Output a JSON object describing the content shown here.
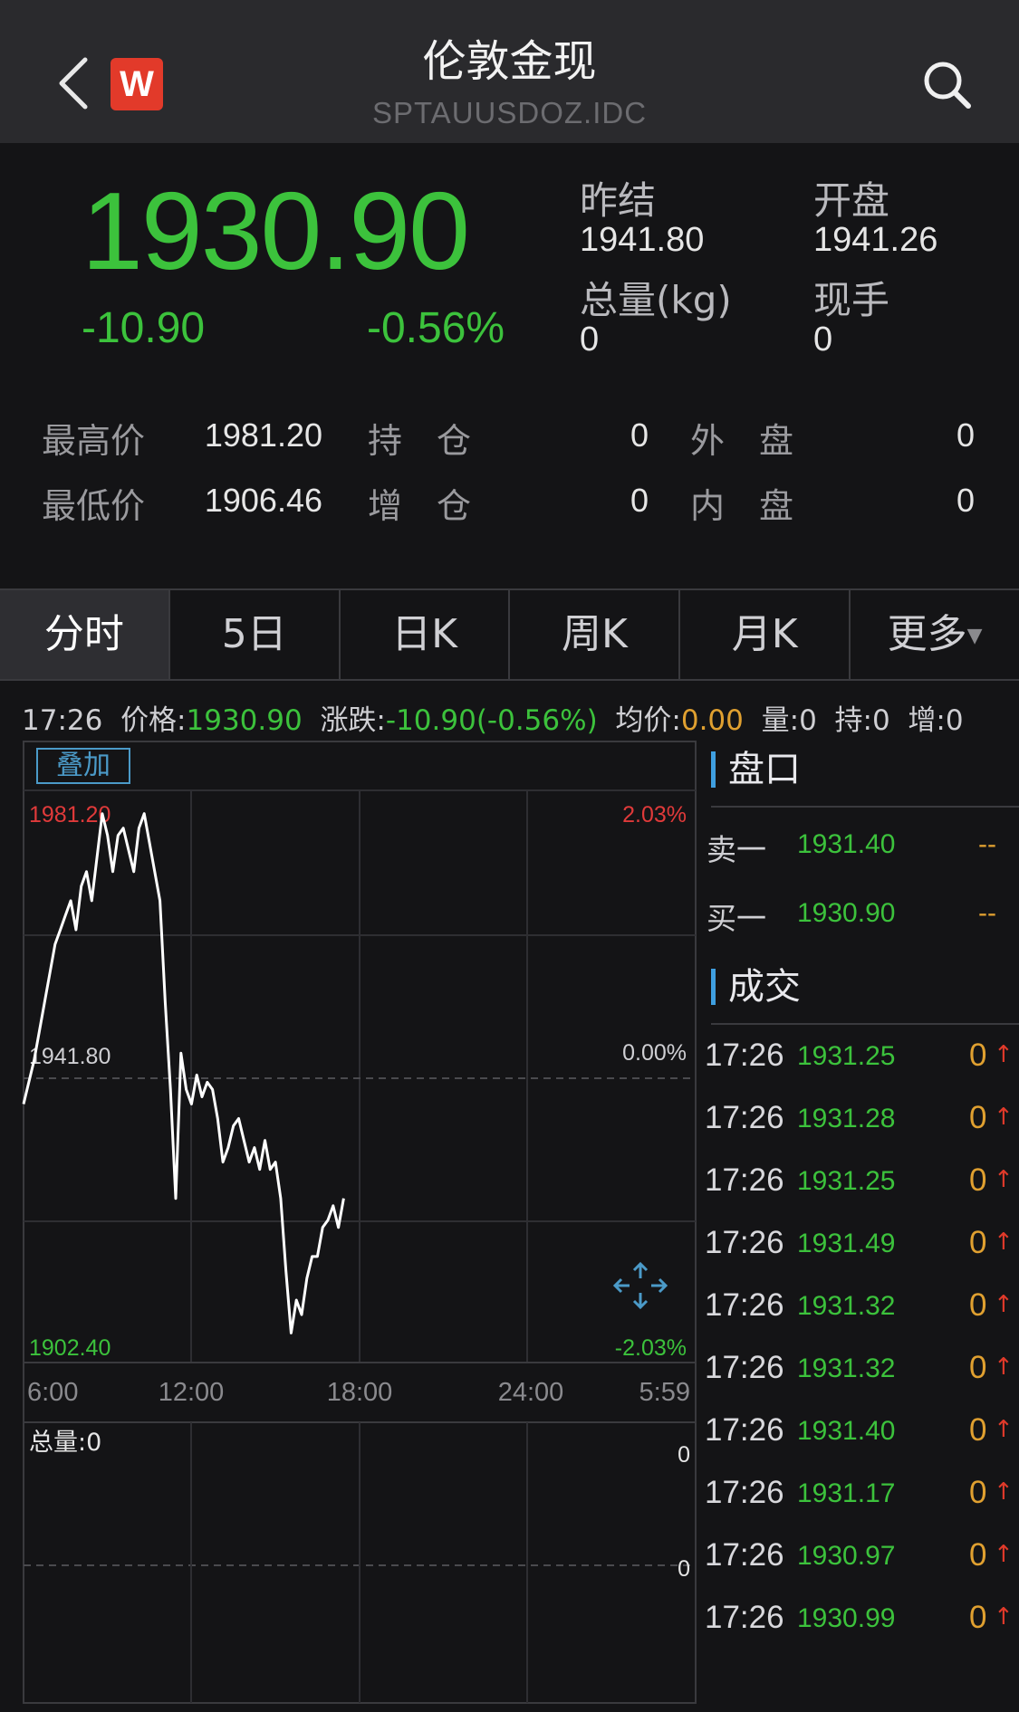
{
  "header": {
    "title": "伦敦金现",
    "subtitle": "SPTAUUSDOZ.IDC",
    "logo_text": "W",
    "back_icon": "chevron-left-icon",
    "search_icon": "search-icon",
    "logo_color": "#e23a2a"
  },
  "quote": {
    "price": "1930.90",
    "change": "-10.90",
    "change_pct": "-0.56%",
    "prev_settle_label": "昨结",
    "prev_settle": "1941.80",
    "open_label": "开盘",
    "open": "1941.26",
    "volume_label": "总量(kg)",
    "volume": "0",
    "current_hand_label": "现手",
    "current_hand": "0",
    "color_down": "#3cc23c"
  },
  "stats": {
    "high_label": "最高价",
    "high": "1981.20",
    "low_label": "最低价",
    "low": "1906.46",
    "open_interest_label": "持　仓",
    "open_interest": "0",
    "oi_change_label": "增　仓",
    "oi_change": "0",
    "outer_label": "外　盘",
    "outer": "0",
    "inner_label": "内　盘",
    "inner": "0"
  },
  "tabs": [
    {
      "label": "分时",
      "active": true
    },
    {
      "label": "5日"
    },
    {
      "label": "日K"
    },
    {
      "label": "周K"
    },
    {
      "label": "月K"
    },
    {
      "label": "更多"
    }
  ],
  "infobar": {
    "time": "17:26",
    "price_label": "价格:",
    "price": "1930.90",
    "chg_label": "涨跌:",
    "chg": "-10.90(-0.56%)",
    "avg_label": "均价:",
    "avg": "0.00",
    "vol_label": "量:",
    "vol": "0",
    "hold_label": "持:",
    "hold": "0",
    "inc_label": "增:",
    "inc": "0"
  },
  "chart": {
    "overlay_button": "叠加",
    "y_top": "1981.20",
    "y_mid": "1941.80",
    "y_bottom": "1902.40",
    "pct_top": "2.03%",
    "pct_mid": "0.00%",
    "pct_bottom": "-2.03%",
    "x_labels": [
      "6:00",
      "12:00",
      "18:00",
      "24:00",
      "5:59"
    ],
    "volume_label": "总量:0",
    "vol_axis_top": "0",
    "vol_axis_mid": "0",
    "expand_icon": "expand-arrows-icon"
  },
  "chart_data": {
    "type": "line",
    "title": "",
    "xlabel": "",
    "ylabel": "",
    "x_range": [
      "6:00",
      "5:59"
    ],
    "ylim": [
      1902.4,
      1981.2
    ],
    "reference": 1941.8,
    "series": [
      {
        "values": [
          1938,
          1941,
          1944,
          1948,
          1952,
          1956,
          1960,
          1962,
          1964,
          1966,
          1962,
          1968,
          1970,
          1966,
          1972,
          1978,
          1975,
          1970,
          1975,
          1976,
          1973,
          1970,
          1976,
          1978,
          1974,
          1970,
          1966,
          1952,
          1940,
          1925,
          1945,
          1940,
          1938,
          1942,
          1939,
          1941,
          1940,
          1936,
          1930,
          1932,
          1935,
          1936,
          1933,
          1930,
          1932,
          1929,
          1933,
          1929,
          1930,
          1925,
          1915,
          1906.46,
          1911,
          1909,
          1914,
          1917,
          1917,
          1921,
          1922,
          1924,
          1921,
          1925
        ]
      }
    ],
    "grid": true
  },
  "orderbook": {
    "title": "盘口",
    "sell_label": "卖一",
    "sell_price": "1931.40",
    "sell_vol": "--",
    "buy_label": "买一",
    "buy_price": "1930.90",
    "buy_vol": "--"
  },
  "trades": {
    "title": "成交",
    "rows": [
      {
        "time": "17:26",
        "price": "1931.25",
        "vol": "0"
      },
      {
        "time": "17:26",
        "price": "1931.28",
        "vol": "0"
      },
      {
        "time": "17:26",
        "price": "1931.25",
        "vol": "0"
      },
      {
        "time": "17:26",
        "price": "1931.49",
        "vol": "0"
      },
      {
        "time": "17:26",
        "price": "1931.32",
        "vol": "0"
      },
      {
        "time": "17:26",
        "price": "1931.32",
        "vol": "0"
      },
      {
        "time": "17:26",
        "price": "1931.40",
        "vol": "0"
      },
      {
        "time": "17:26",
        "price": "1931.17",
        "vol": "0"
      },
      {
        "time": "17:26",
        "price": "1930.97",
        "vol": "0"
      },
      {
        "time": "17:26",
        "price": "1930.99",
        "vol": "0"
      }
    ],
    "arrow_icon": "up-arrow-icon"
  }
}
